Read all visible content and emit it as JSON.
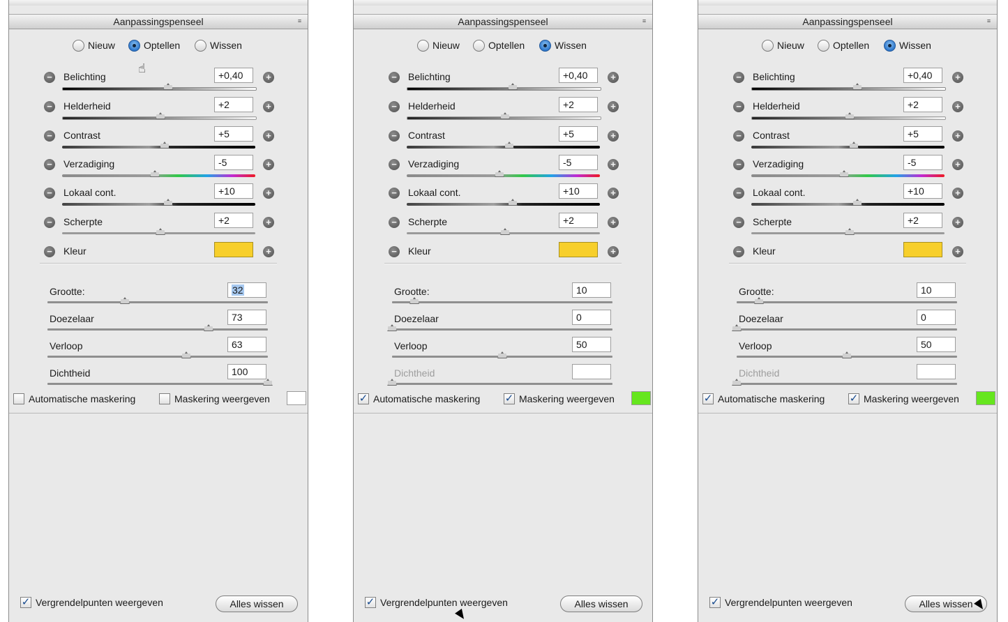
{
  "panels": [
    {
      "title": "Aanpassingspenseel",
      "mode_options": [
        "Nieuw",
        "Optellen",
        "Wissen"
      ],
      "selected_mode": "Optellen",
      "adjustments": [
        {
          "label": "Belichting",
          "value": "+0,40",
          "level": 0.55
        },
        {
          "label": "Helderheid",
          "value": "+2",
          "level": 0.51
        },
        {
          "label": "Contrast",
          "value": "+5",
          "level": 0.53
        },
        {
          "label": "Verzadiging",
          "value": "-5",
          "level": 0.48
        },
        {
          "label": "Lokaal cont.",
          "value": "+10",
          "level": 0.55
        },
        {
          "label": "Scherpte",
          "value": "+2",
          "level": 0.51
        }
      ],
      "color_label": "Kleur",
      "color_value": "#f7cf2b",
      "brush": [
        {
          "label": "Grootte:",
          "value": "32",
          "selected": true,
          "level": 0.35,
          "disabled": false
        },
        {
          "label": "Doezelaar",
          "value": "73",
          "level": 0.73,
          "disabled": false
        },
        {
          "label": "Verloop",
          "value": "63",
          "level": 0.63,
          "disabled": false
        },
        {
          "label": "Dichtheid",
          "value": "100",
          "level": 1.0,
          "disabled": false
        }
      ],
      "auto_mask_label": "Automatische maskering",
      "auto_mask_checked": false,
      "show_mask_label": "Maskering weergeven",
      "show_mask_checked": false,
      "mask_color": "#ffffff",
      "pins_label": "Vergrendelpunten weergeven",
      "pins_checked": true,
      "clear_all_label": "Alles wissen"
    },
    {
      "title": "Aanpassingspenseel",
      "mode_options": [
        "Nieuw",
        "Optellen",
        "Wissen"
      ],
      "selected_mode": "Wissen",
      "adjustments": [
        {
          "label": "Belichting",
          "value": "+0,40",
          "level": 0.55
        },
        {
          "label": "Helderheid",
          "value": "+2",
          "level": 0.51
        },
        {
          "label": "Contrast",
          "value": "+5",
          "level": 0.53
        },
        {
          "label": "Verzadiging",
          "value": "-5",
          "level": 0.48
        },
        {
          "label": "Lokaal cont.",
          "value": "+10",
          "level": 0.55
        },
        {
          "label": "Scherpte",
          "value": "+2",
          "level": 0.51
        }
      ],
      "color_label": "Kleur",
      "color_value": "#f7cf2b",
      "brush": [
        {
          "label": "Grootte:",
          "value": "10",
          "level": 0.1,
          "disabled": false
        },
        {
          "label": "Doezelaar",
          "value": "0",
          "level": 0.0,
          "disabled": false
        },
        {
          "label": "Verloop",
          "value": "50",
          "level": 0.5,
          "disabled": false
        },
        {
          "label": "Dichtheid",
          "value": "",
          "level": 0.0,
          "disabled": true
        }
      ],
      "auto_mask_label": "Automatische maskering",
      "auto_mask_checked": true,
      "show_mask_label": "Maskering weergeven",
      "show_mask_checked": true,
      "mask_color": "#66e61e",
      "pins_label": "Vergrendelpunten weergeven",
      "pins_checked": true,
      "clear_all_label": "Alles wissen"
    },
    {
      "title": "Aanpassingspenseel",
      "mode_options": [
        "Nieuw",
        "Optellen",
        "Wissen"
      ],
      "selected_mode": "Wissen",
      "adjustments": [
        {
          "label": "Belichting",
          "value": "+0,40",
          "level": 0.55
        },
        {
          "label": "Helderheid",
          "value": "+2",
          "level": 0.51
        },
        {
          "label": "Contrast",
          "value": "+5",
          "level": 0.53
        },
        {
          "label": "Verzadiging",
          "value": "-5",
          "level": 0.48
        },
        {
          "label": "Lokaal cont.",
          "value": "+10",
          "level": 0.55
        },
        {
          "label": "Scherpte",
          "value": "+2",
          "level": 0.51
        }
      ],
      "color_label": "Kleur",
      "color_value": "#f7cf2b",
      "brush": [
        {
          "label": "Grootte:",
          "value": "10",
          "level": 0.1,
          "disabled": false
        },
        {
          "label": "Doezelaar",
          "value": "0",
          "level": 0.0,
          "disabled": false
        },
        {
          "label": "Verloop",
          "value": "50",
          "level": 0.5,
          "disabled": false
        },
        {
          "label": "Dichtheid",
          "value": "",
          "level": 0.0,
          "disabled": true
        }
      ],
      "auto_mask_label": "Automatische maskering",
      "auto_mask_checked": true,
      "show_mask_label": "Maskering weergeven",
      "show_mask_checked": true,
      "mask_color": "#66e61e",
      "pins_label": "Vergrendelpunten weergeven",
      "pins_checked": true,
      "clear_all_label": "Alles wissen"
    }
  ]
}
